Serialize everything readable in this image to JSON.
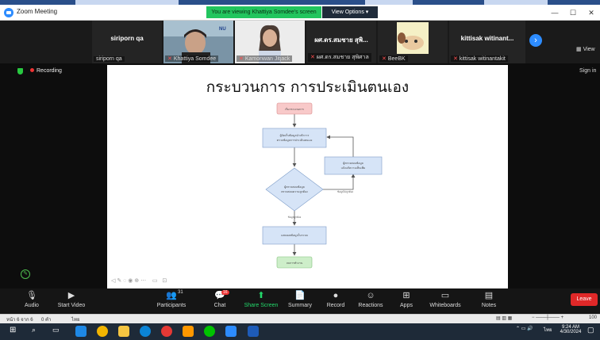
{
  "window": {
    "title": "Zoom Meeting",
    "share_banner": "You are viewing Khattiya Somdee's screen",
    "view_options": "View Options",
    "minimize": "—",
    "maximize": "☐",
    "close": "✕"
  },
  "gallery": {
    "view_label": "View",
    "tiles": [
      {
        "display": "siriporn qa",
        "label": "siriporn qa"
      },
      {
        "display": "",
        "label": "Khattiya Somdee"
      },
      {
        "display": "",
        "label": "Kamonwan Jitjack"
      },
      {
        "display": "ผศ.ดร.สมชาย สุพิ...",
        "label": "ผศ.ดร.สมชาย สุพิศาล"
      },
      {
        "display": "",
        "label": "BeeBK"
      },
      {
        "display": "kittisak witinant...",
        "label": "kittisak witinantakit"
      }
    ],
    "next": "›"
  },
  "status": {
    "recording": "Recording",
    "sign_in": "Sign in"
  },
  "slide": {
    "title": "กระบวนการ การประเมินตนเอง",
    "flow": {
      "start": "เริ่มกระบวนการ",
      "step1": "ผู้จัดเก็บข้อมูลนำเข้าการ",
      "step1b": "ตรวจข้อมูลการประเมินตนเอง",
      "decision": "ผู้ตรวจสอบข้อมูล",
      "decisionb": "ตรวจสอบความถูกต้อง",
      "revise": "ผู้ตรวจสอบข้อมูล",
      "reviseb": "แจ้งแก้ความเห็นเพิ่ม",
      "no_label": "ข้อมูลไม่ถูกต้อง",
      "yes_label": "ข้อมูลถูกต้อง",
      "report": "แสดงผลข้อมูลในระบบ",
      "end": "จบการทำงาน"
    }
  },
  "toolbar": {
    "audio": "Audio",
    "video": "Start Video",
    "participants": "Participants",
    "participants_count": "31",
    "chat": "Chat",
    "chat_badge": "16",
    "share": "Share Screen",
    "summary": "Summary",
    "record": "Record",
    "reactions": "Reactions",
    "apps": "Apps",
    "whiteboards": "Whiteboards",
    "notes": "Notes",
    "leave": "Leave"
  },
  "statusbar": {
    "page": "หน้า 6 จาก 6",
    "words": "0 คำ",
    "lang": "ไทย",
    "zoom": "100"
  },
  "taskbar": {
    "time": "9:24 AM",
    "date": "4/30/2024",
    "lang": "ไทย"
  },
  "colors": {
    "share_green": "#22c55e",
    "zoom_blue": "#2d8cff",
    "leave_red": "#e02828"
  }
}
